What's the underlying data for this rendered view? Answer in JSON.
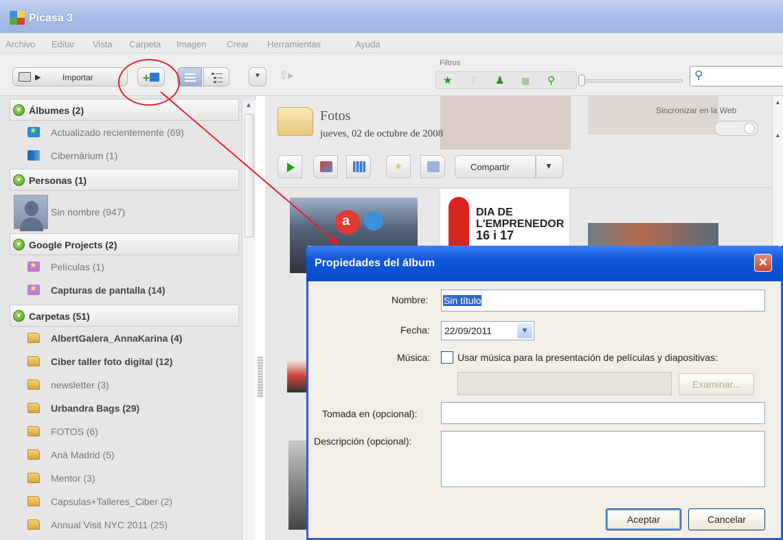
{
  "window": {
    "title": "Picasa 3"
  },
  "menu": [
    "Archivo",
    "Editar",
    "Vista",
    "Carpeta",
    "Imagen",
    "Crear",
    "Herramientas",
    "Ayuda"
  ],
  "toolbar": {
    "import_label": "Importar",
    "filters_label": "Filtros",
    "filter_icons": [
      "star-filter-icon",
      "upload-filter-icon",
      "person-filter-icon",
      "movie-filter-icon",
      "geotag-filter-icon"
    ]
  },
  "sidebar": {
    "sections": [
      {
        "label": "Álbumes (2)"
      },
      {
        "label": "Personas (1)"
      },
      {
        "label": "Google Projects (2)"
      },
      {
        "label": "Carpetas (51)"
      }
    ],
    "albums": [
      {
        "label": "Actualizado recientemente (69)"
      },
      {
        "label": "Cibernàrium (1)"
      }
    ],
    "people": [
      {
        "label": "Sin nombre (947)"
      }
    ],
    "projects": [
      {
        "label": "Películas (1)"
      },
      {
        "label": "Capturas de pantalla (14)"
      }
    ],
    "folders": [
      {
        "label": "AlbertGalera_AnnaKarina (4)"
      },
      {
        "label": "Ciber taller foto digital (12)"
      },
      {
        "label": "newsletter (3)"
      },
      {
        "label": "Urbandra Bags (29)"
      },
      {
        "label": "FOTOS (6)"
      },
      {
        "label": "Aná Madrid (5)"
      },
      {
        "label": "Mentor (3)"
      },
      {
        "label": "Capsulas+Talleres_Ciber (2)"
      },
      {
        "label": "Annual Visit NYC 2011 (25)"
      }
    ]
  },
  "main": {
    "folder_title": "Fotos",
    "folder_date": "jueves, 02 de octubre de 2008",
    "sync_label": "Sincronizar en la Web",
    "share_label": "Compartir",
    "thumbnail_text": {
      "line1": "DIA DE",
      "line2": "L'EMPRENEDOR",
      "line3": "16 i 17"
    }
  },
  "dialog": {
    "title": "Propiedades del álbum",
    "name_label": "Nombre:",
    "name_value": "Sin título",
    "date_label": "Fecha:",
    "date_value": "22/09/2011",
    "music_label": "Música:",
    "music_checkbox_label": "Usar música para la presentación de películas y diapositivas:",
    "browse_label": "Examinar...",
    "taken_label": "Tomada en (opcional):",
    "description_label": "Descripción (opcional):",
    "accept_label": "Aceptar",
    "cancel_label": "Cancelar"
  },
  "colors": {
    "annotation": "#e4212b",
    "dialog_title": "#0f56d8",
    "toggle_green": "#4c9a1c"
  }
}
